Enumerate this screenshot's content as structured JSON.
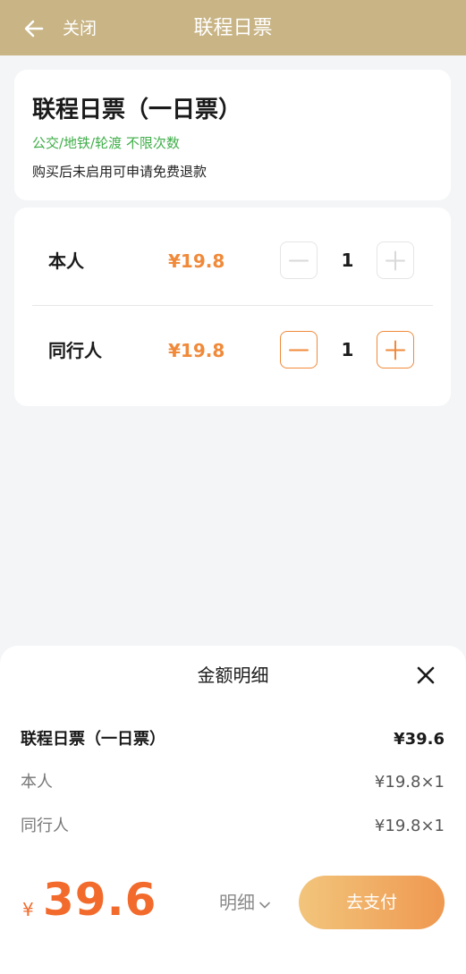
{
  "header": {
    "close_label": "关闭",
    "title": "联程日票"
  },
  "ticket": {
    "title": "联程日票（一日票）",
    "scope": "公交/地铁/轮渡 不限次数",
    "refund_note": "购买后未启用可申请免费退款"
  },
  "passengers": [
    {
      "name": "本人",
      "price": "¥19.8",
      "quantity": "1",
      "minus_enabled": false,
      "plus_enabled": false
    },
    {
      "name": "同行人",
      "price": "¥19.8",
      "quantity": "1",
      "minus_enabled": true,
      "plus_enabled": true
    }
  ],
  "detail_sheet": {
    "title": "金额明细",
    "rows": [
      {
        "label": "联程日票（一日票）",
        "value": "¥39.6"
      },
      {
        "label": "本人",
        "value": "¥19.8×1"
      },
      {
        "label": "同行人",
        "value": "¥19.8×1"
      }
    ]
  },
  "pay_bar": {
    "currency": "¥",
    "total": "39.6",
    "detail_toggle_label": "明细",
    "pay_label": "去支付"
  },
  "colors": {
    "header_bg": "#c8b485",
    "accent_orange": "#f08a3a",
    "total_orange": "#f26b2c",
    "scope_green": "#3fae49",
    "page_bg": "#f4f5f7"
  },
  "icons": {
    "back": "arrow-left-icon",
    "close": "close-icon",
    "minus": "minus-icon",
    "plus": "plus-icon",
    "chevron": "chevron-down-icon"
  }
}
